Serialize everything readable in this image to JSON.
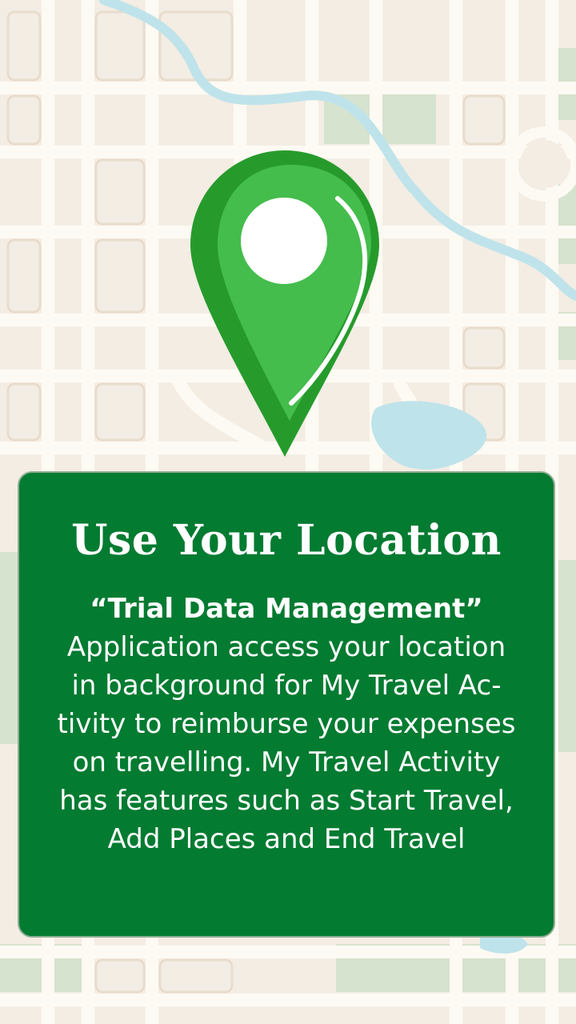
{
  "screen": {
    "title": "Use Your Location",
    "app_quote": "“Trial Data Management”",
    "description_lines": [
      "Application access your location",
      "in background for My Travel Ac-",
      "tivity to reimburse your expenses",
      "on travelling. My Travel Activity",
      "has features such as Start Travel,",
      "Add Places and End Travel"
    ]
  },
  "icons": {
    "pin": "location-pin-icon",
    "background": "map-illustration"
  },
  "colors": {
    "card_background": "#037b31",
    "pin_green": "#36ae3f",
    "pin_dark_green": "#269b2c",
    "map_background": "#f3ede4",
    "map_roads": "#fdfaf3",
    "map_water": "#bfe3ea",
    "map_parks": "#d6e3cf"
  }
}
